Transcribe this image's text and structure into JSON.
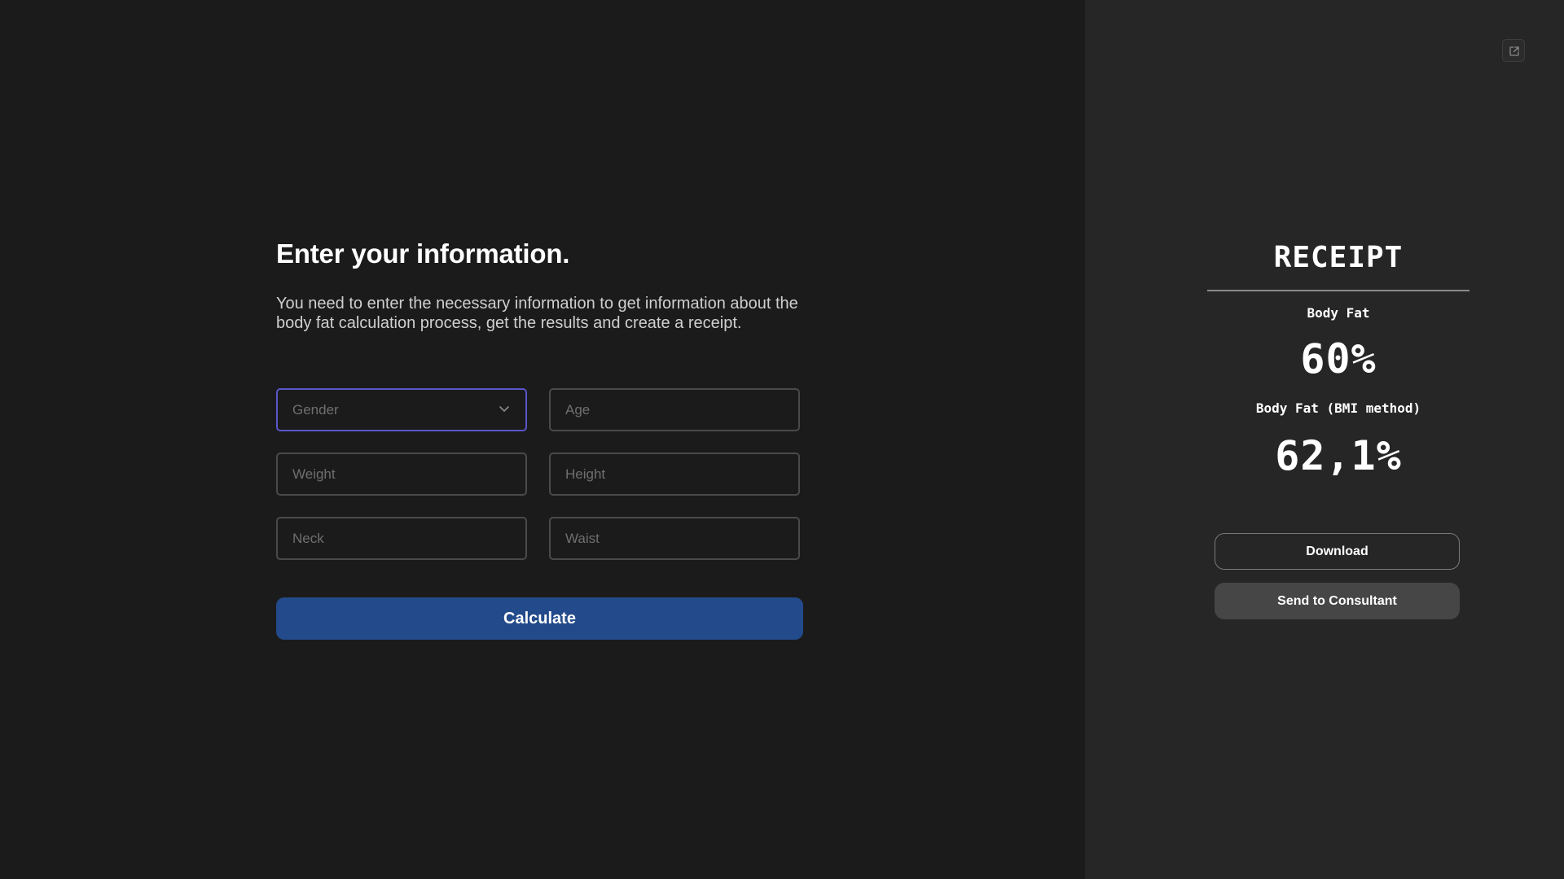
{
  "form": {
    "title": "Enter your information.",
    "description": "You need to enter the necessary information to get information about the body fat calculation process, get the results and create a receipt.",
    "fields": {
      "gender": {
        "placeholder": "Gender",
        "value": ""
      },
      "age": {
        "placeholder": "Age",
        "value": ""
      },
      "weight": {
        "placeholder": "Weight",
        "value": ""
      },
      "height": {
        "placeholder": "Height",
        "value": ""
      },
      "neck": {
        "placeholder": "Neck",
        "value": ""
      },
      "waist": {
        "placeholder": "Waist",
        "value": ""
      }
    },
    "calculate_label": "Calculate"
  },
  "receipt": {
    "title": "RECEIPT",
    "body_fat_label": "Body Fat",
    "body_fat_value": "60%",
    "bmi_label": "Body Fat (BMI method)",
    "bmi_value": "62,1%",
    "download_label": "Download",
    "send_label": "Send to Consultant"
  },
  "icons": {
    "gender_select": "chevron-down-icon",
    "open_external": "external-link-icon"
  },
  "colors": {
    "background_left": "#1b1b1b",
    "background_right": "#262626",
    "accent_button": "#234a8a",
    "select_focus_border": "#5a55c9",
    "secondary_button": "#464646"
  }
}
